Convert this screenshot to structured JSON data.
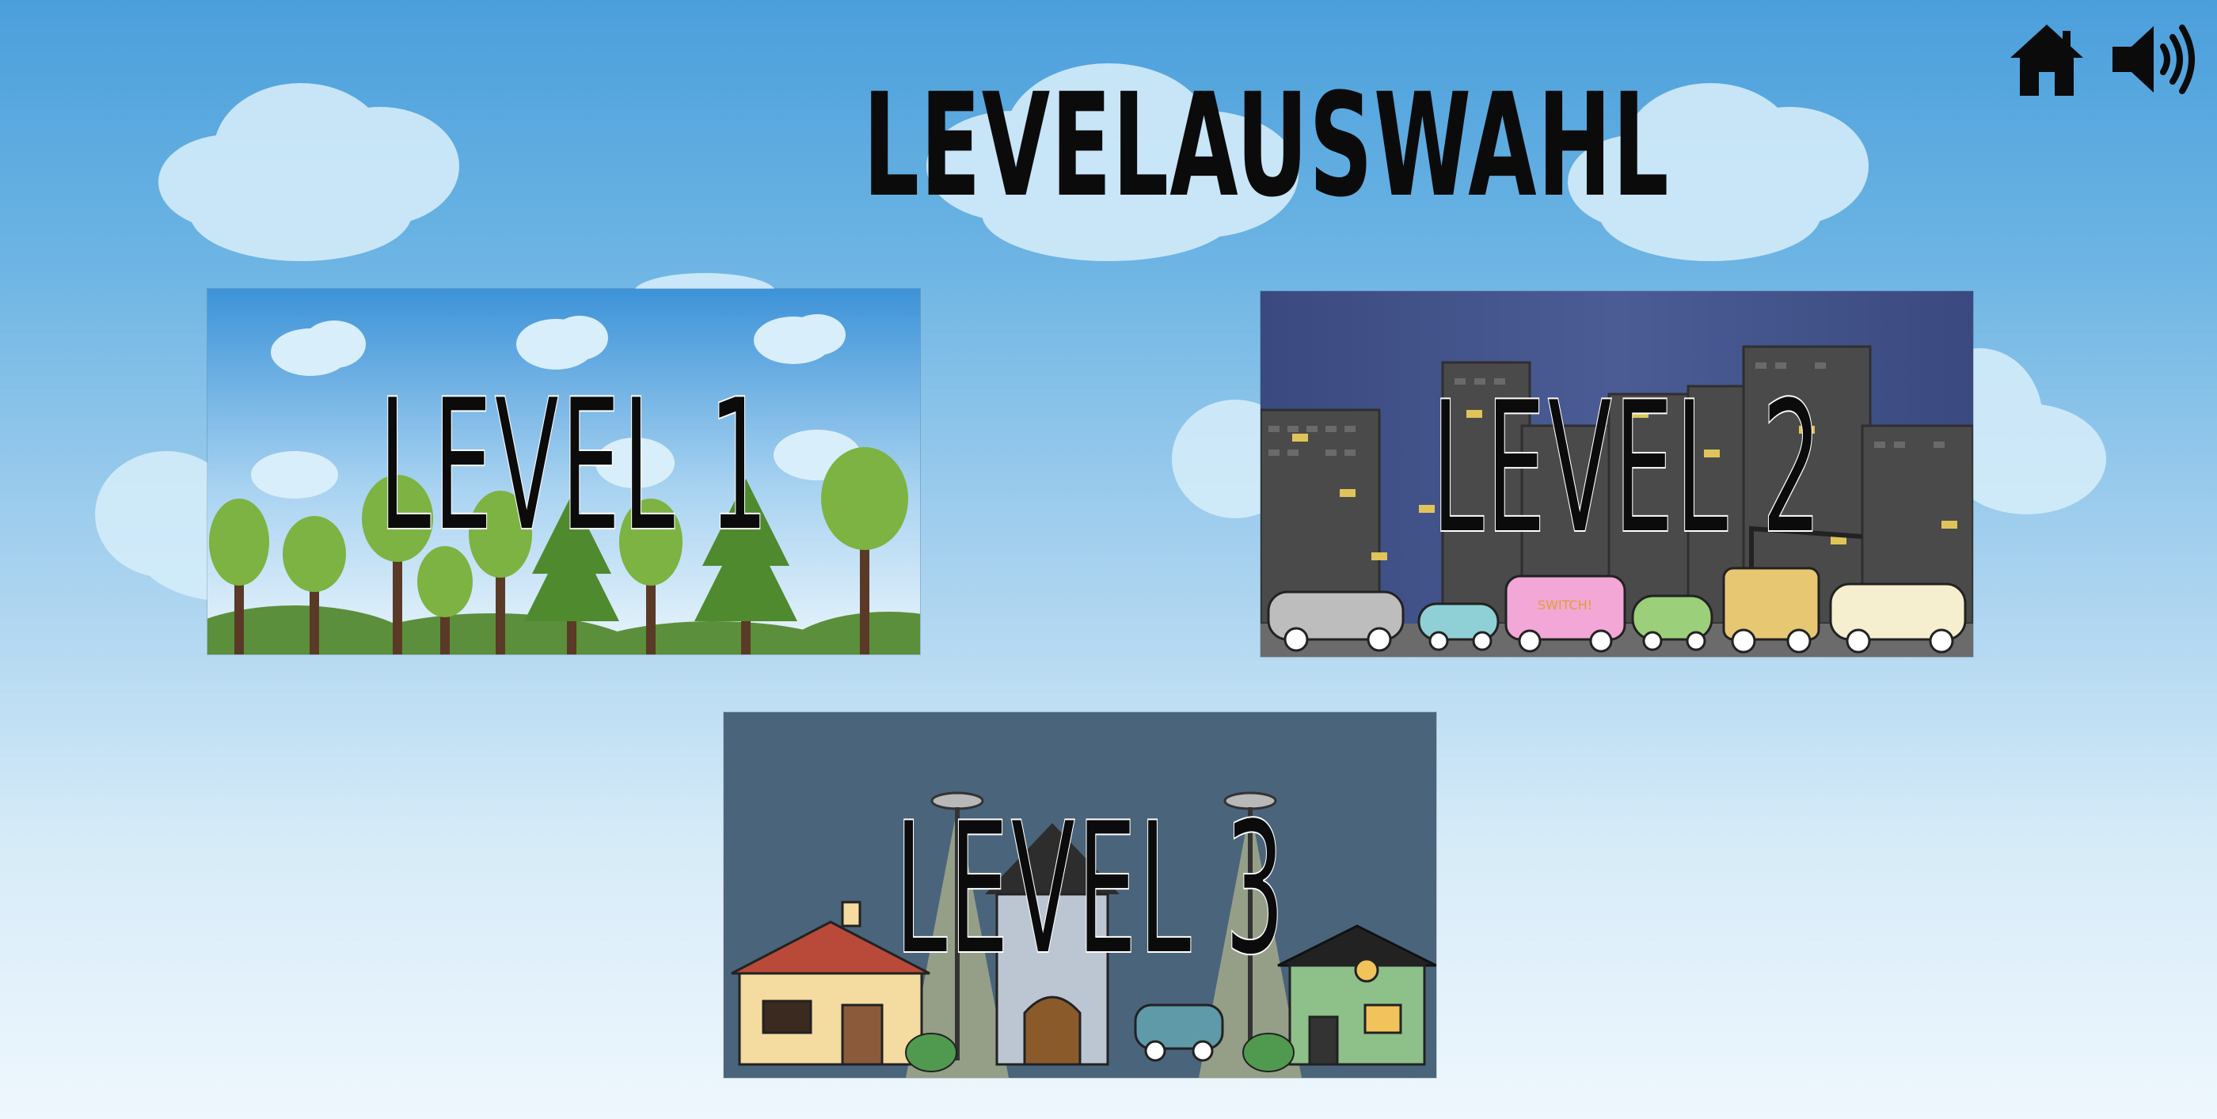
{
  "screen": {
    "title": "LEVELAUSWAHL"
  },
  "toolbar": {
    "home_icon": "home-icon",
    "sound_icon": "speaker-icon"
  },
  "levels": [
    {
      "label": "LEVEL 1",
      "theme": "forest"
    },
    {
      "label": "LEVEL 2",
      "theme": "city-night",
      "sign_text": "SWITCH!"
    },
    {
      "label": "LEVEL 3",
      "theme": "neighborhood-night"
    }
  ],
  "colors": {
    "sky_top": "#4b9fdc",
    "sky_bottom": "#eef7fd",
    "title_text": "#0b0b0b",
    "level2_bg": "#3f4f86",
    "level3_bg": "#4a647b"
  }
}
